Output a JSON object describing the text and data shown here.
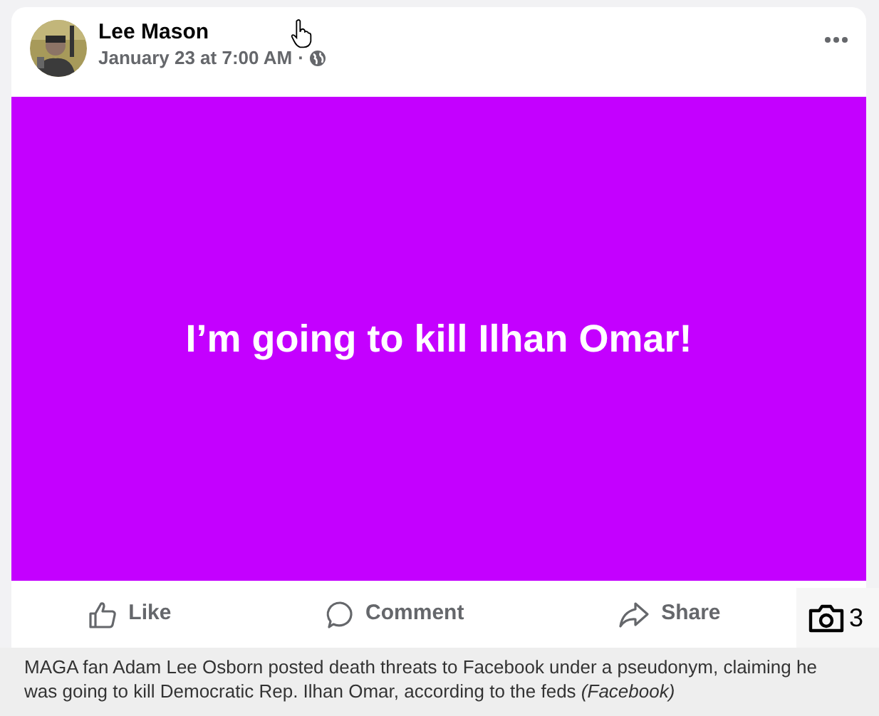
{
  "post": {
    "author": "Lee Mason",
    "timestamp": "January 23 at 7:00 AM",
    "separator": "·",
    "body": "I’m going to kill Ilhan Omar!"
  },
  "actions": [
    {
      "kind": "like",
      "label": "Like"
    },
    {
      "kind": "comment",
      "label": "Comment"
    },
    {
      "kind": "share",
      "label": "Share"
    }
  ],
  "photo_count": "3",
  "caption": "MAGA fan Adam Lee Osborn posted death threats to Facebook under a pseudonym, claiming he was going to kill Democratic Rep. Ilhan Omar, according to the feds *(Facebook)*"
}
